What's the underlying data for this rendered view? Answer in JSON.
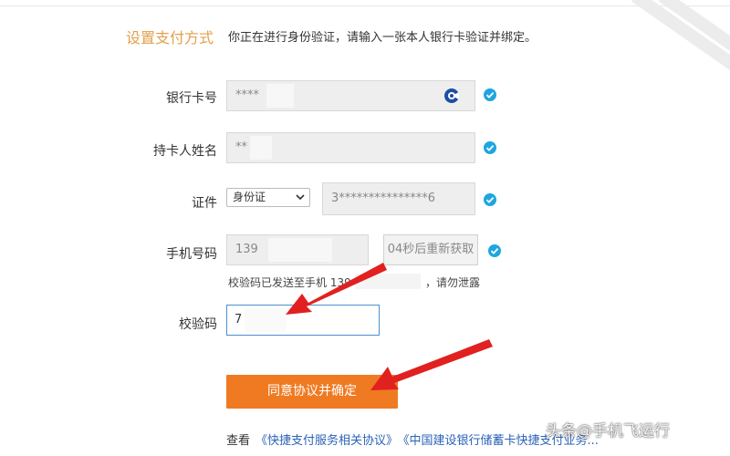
{
  "header": {
    "title": "设置支付方式",
    "description": "你正在进行身份验证，请输入一张本人银行卡验证并绑定。"
  },
  "form": {
    "card_number": {
      "label": "银行卡号",
      "value": "****"
    },
    "holder_name": {
      "label": "持卡人姓名",
      "value": "**"
    },
    "id_type": {
      "label": "证件",
      "selected": "身份证",
      "value": "3***************6"
    },
    "phone": {
      "label": "手机号码",
      "value": "139",
      "resend_label": "04秒后重新获取"
    },
    "sms_hint": {
      "prefix": "校验码已发送至手机 139",
      "suffix": "，请勿泄露"
    },
    "verify_code": {
      "label": "校验码",
      "value": "7"
    }
  },
  "submit_label": "同意协议并确定",
  "terms": {
    "prefix": "查看",
    "link1": "《快捷支付服务相关协议》",
    "link2": "《中国建设银行储蓄卡快捷支付业务..."
  },
  "watermark": "头条@手机飞运行",
  "colors": {
    "accent_orange": "#f07a22",
    "title_gold": "#e2a04a",
    "check_blue": "#1ea6e0",
    "link_blue": "#2b63b8",
    "arrow_red": "#e0211f"
  },
  "icons": [
    "bank-logo-icon",
    "check-icon",
    "chevron-down-icon",
    "arrow-icon"
  ]
}
